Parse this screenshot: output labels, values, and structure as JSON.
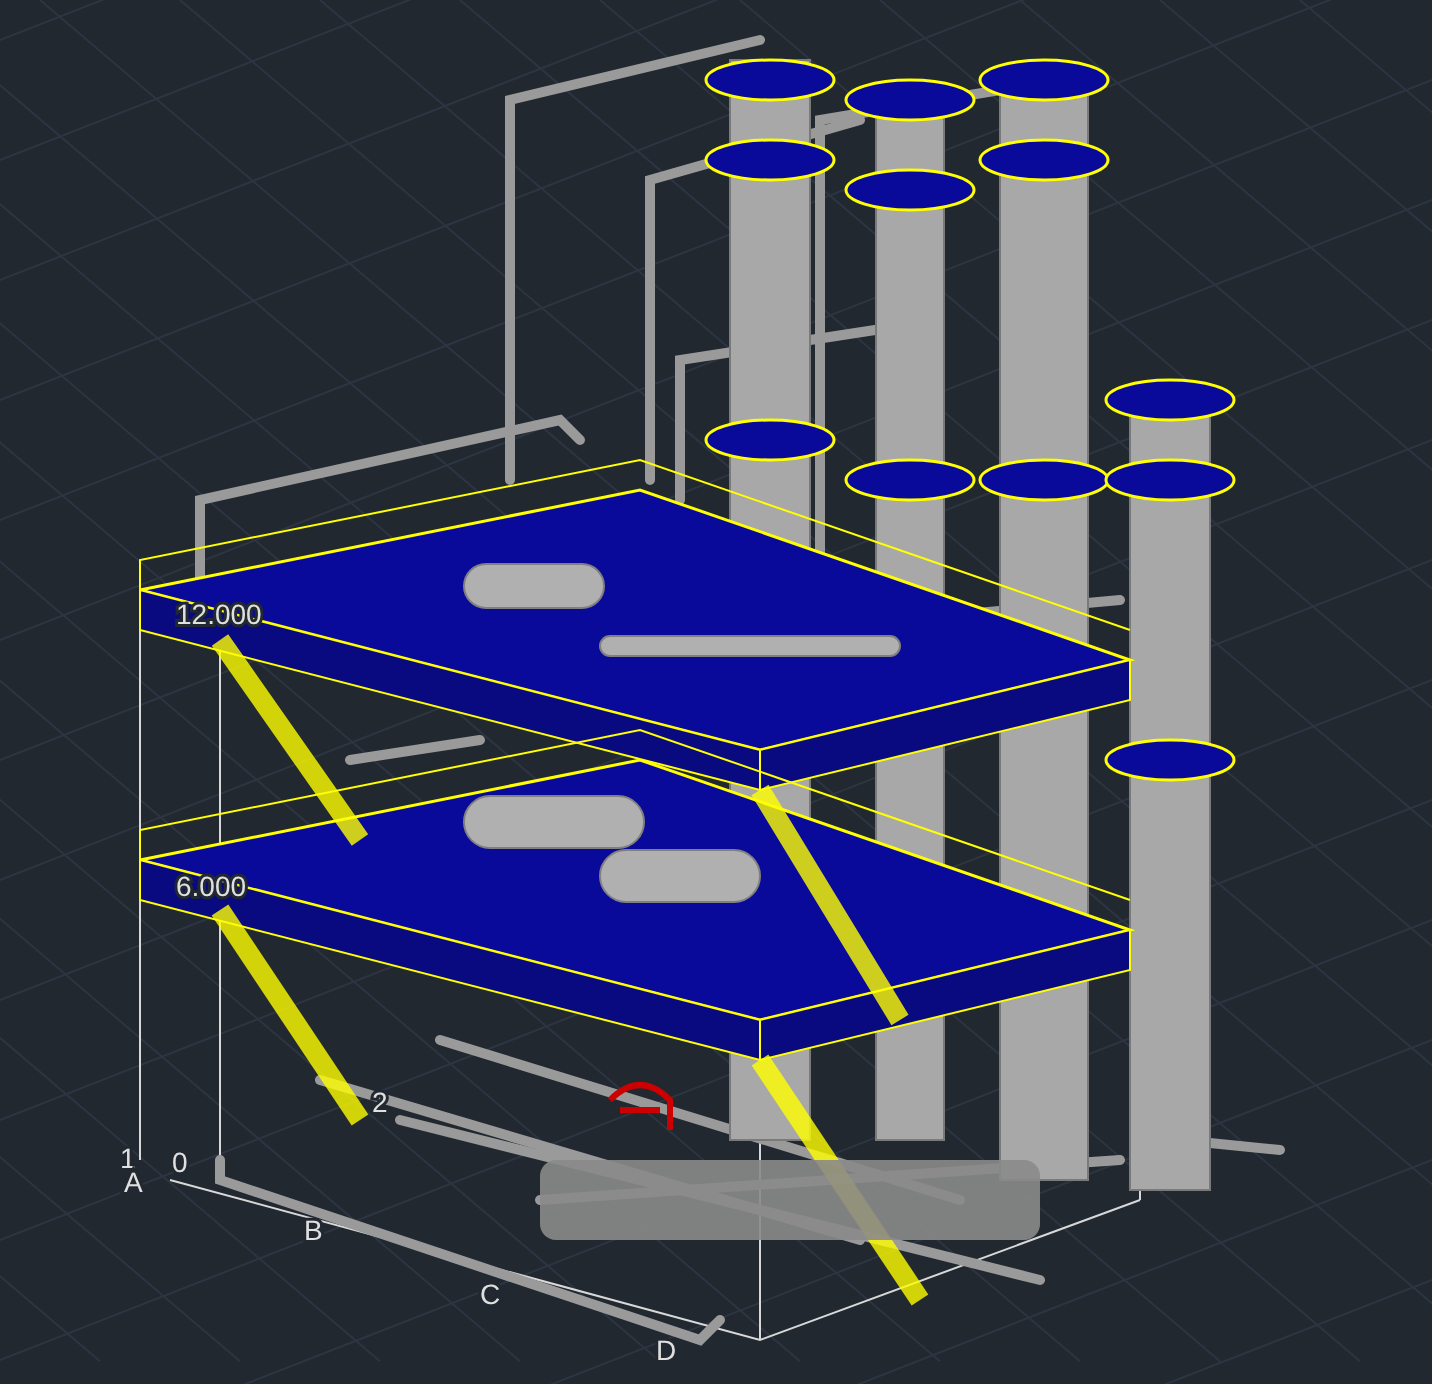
{
  "viewport": {
    "elevation_labels": [
      "12.000",
      "6.000",
      "0"
    ],
    "grid_labels": [
      "1",
      "A",
      "B",
      "C",
      "D",
      "2"
    ]
  }
}
